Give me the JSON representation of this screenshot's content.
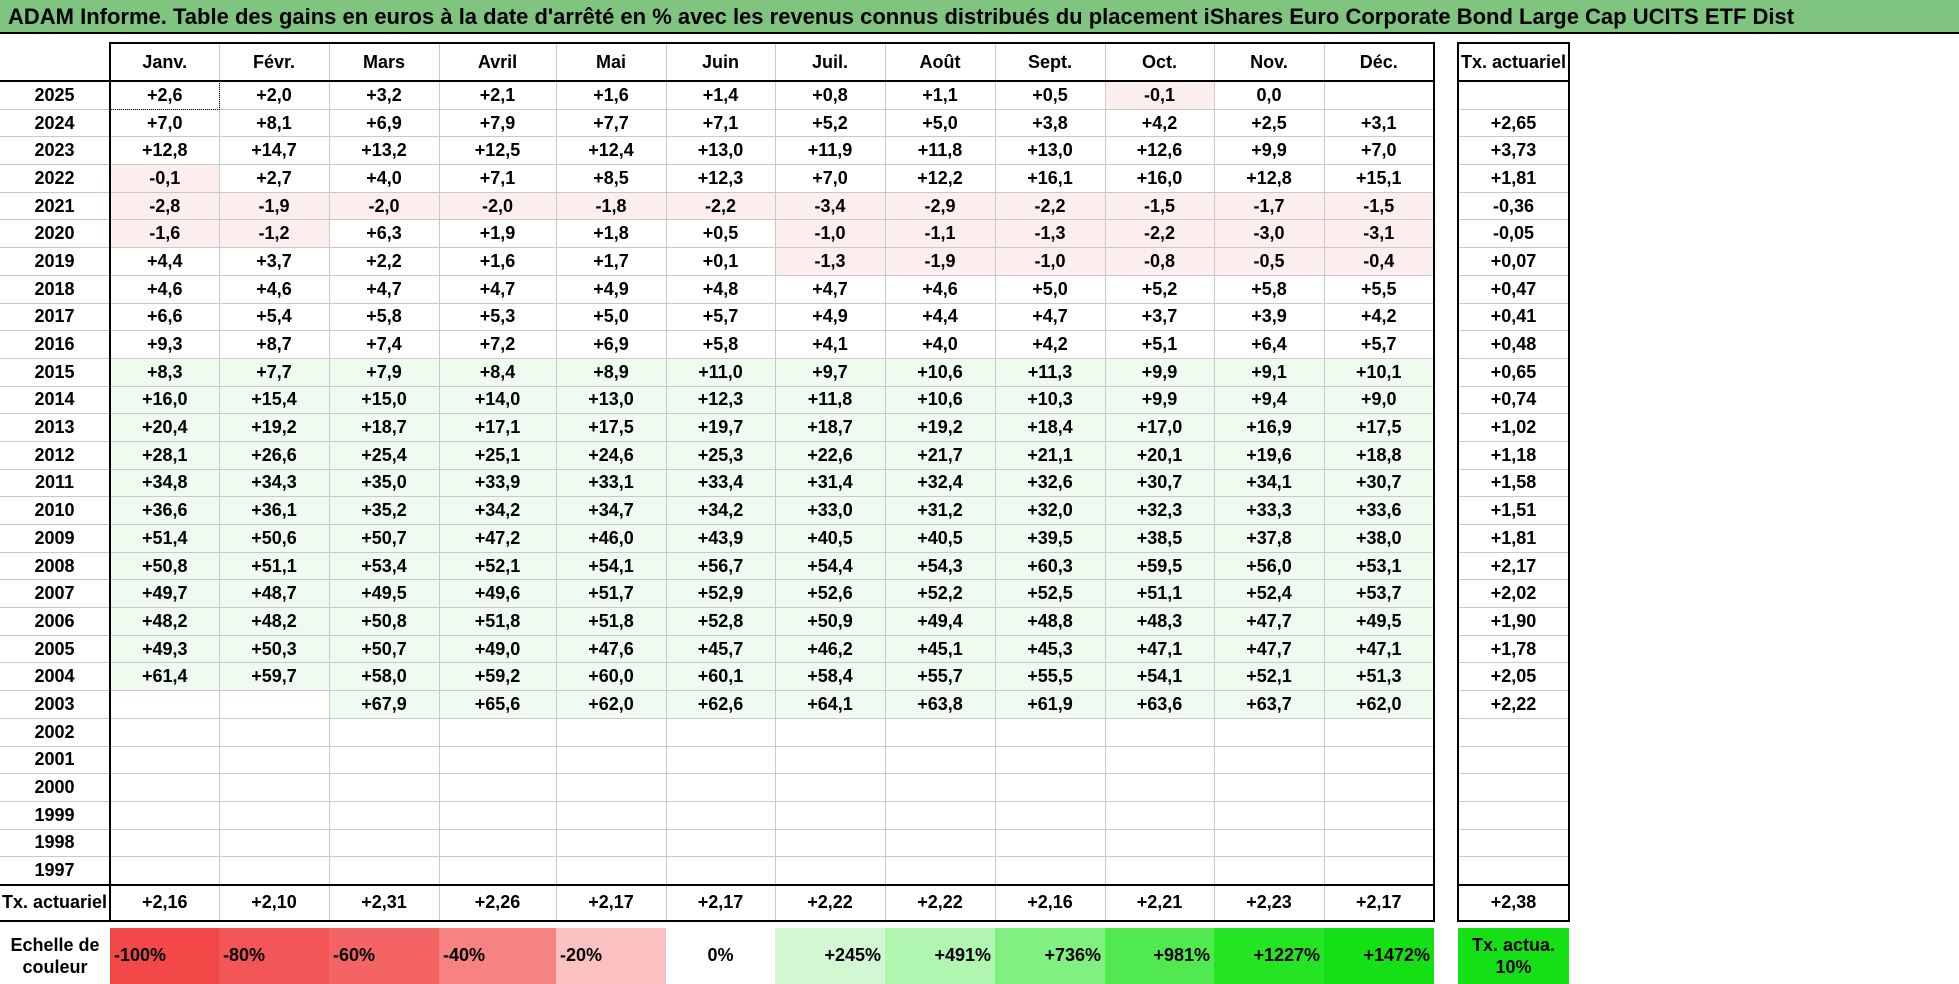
{
  "title": "ADAM Informe. Table des gains en euros à la date d'arrêté en % avec les revenus connus distribués du placement iShares Euro Corporate Bond Large Cap UCITS ETF Dist",
  "months": [
    "Janv.",
    "Févr.",
    "Mars",
    "Avril",
    "Mai",
    "Juin",
    "Juil.",
    "Août",
    "Sept.",
    "Oct.",
    "Nov.",
    "Déc."
  ],
  "tx_header": "Tx. actuariel",
  "rows": [
    {
      "year": "2025",
      "cells": [
        "+2,6",
        "+2,0",
        "+3,2",
        "+2,1",
        "+1,6",
        "+1,4",
        "+0,8",
        "+1,1",
        "+0,5",
        "-0,1",
        "0,0",
        ""
      ],
      "tx": ""
    },
    {
      "year": "2024",
      "cells": [
        "+7,0",
        "+8,1",
        "+6,9",
        "+7,9",
        "+7,7",
        "+7,1",
        "+5,2",
        "+5,0",
        "+3,8",
        "+4,2",
        "+2,5",
        "+3,1"
      ],
      "tx": "+2,65"
    },
    {
      "year": "2023",
      "cells": [
        "+12,8",
        "+14,7",
        "+13,2",
        "+12,5",
        "+12,4",
        "+13,0",
        "+11,9",
        "+11,8",
        "+13,0",
        "+12,6",
        "+9,9",
        "+7,0"
      ],
      "tx": "+3,73"
    },
    {
      "year": "2022",
      "cells": [
        "-0,1",
        "+2,7",
        "+4,0",
        "+7,1",
        "+8,5",
        "+12,3",
        "+7,0",
        "+12,2",
        "+16,1",
        "+16,0",
        "+12,8",
        "+15,1"
      ],
      "tx": "+1,81"
    },
    {
      "year": "2021",
      "cells": [
        "-2,8",
        "-1,9",
        "-2,0",
        "-2,0",
        "-1,8",
        "-2,2",
        "-3,4",
        "-2,9",
        "-2,2",
        "-1,5",
        "-1,7",
        "-1,5"
      ],
      "tx": "-0,36"
    },
    {
      "year": "2020",
      "cells": [
        "-1,6",
        "-1,2",
        "+6,3",
        "+1,9",
        "+1,8",
        "+0,5",
        "-1,0",
        "-1,1",
        "-1,3",
        "-2,2",
        "-3,0",
        "-3,1"
      ],
      "tx": "-0,05"
    },
    {
      "year": "2019",
      "cells": [
        "+4,4",
        "+3,7",
        "+2,2",
        "+1,6",
        "+1,7",
        "+0,1",
        "-1,3",
        "-1,9",
        "-1,0",
        "-0,8",
        "-0,5",
        "-0,4"
      ],
      "tx": "+0,07"
    },
    {
      "year": "2018",
      "cells": [
        "+4,6",
        "+4,6",
        "+4,7",
        "+4,7",
        "+4,9",
        "+4,8",
        "+4,7",
        "+4,6",
        "+5,0",
        "+5,2",
        "+5,8",
        "+5,5"
      ],
      "tx": "+0,47"
    },
    {
      "year": "2017",
      "cells": [
        "+6,6",
        "+5,4",
        "+5,8",
        "+5,3",
        "+5,0",
        "+5,7",
        "+4,9",
        "+4,4",
        "+4,7",
        "+3,7",
        "+3,9",
        "+4,2"
      ],
      "tx": "+0,41"
    },
    {
      "year": "2016",
      "cells": [
        "+9,3",
        "+8,7",
        "+7,4",
        "+7,2",
        "+6,9",
        "+5,8",
        "+4,1",
        "+4,0",
        "+4,2",
        "+5,1",
        "+6,4",
        "+5,7"
      ],
      "tx": "+0,48"
    },
    {
      "year": "2015",
      "cells": [
        "+8,3",
        "+7,7",
        "+7,9",
        "+8,4",
        "+8,9",
        "+11,0",
        "+9,7",
        "+10,6",
        "+11,3",
        "+9,9",
        "+9,1",
        "+10,1"
      ],
      "tx": "+0,65"
    },
    {
      "year": "2014",
      "cells": [
        "+16,0",
        "+15,4",
        "+15,0",
        "+14,0",
        "+13,0",
        "+12,3",
        "+11,8",
        "+10,6",
        "+10,3",
        "+9,9",
        "+9,4",
        "+9,0"
      ],
      "tx": "+0,74"
    },
    {
      "year": "2013",
      "cells": [
        "+20,4",
        "+19,2",
        "+18,7",
        "+17,1",
        "+17,5",
        "+19,7",
        "+18,7",
        "+19,2",
        "+18,4",
        "+17,0",
        "+16,9",
        "+17,5"
      ],
      "tx": "+1,02"
    },
    {
      "year": "2012",
      "cells": [
        "+28,1",
        "+26,6",
        "+25,4",
        "+25,1",
        "+24,6",
        "+25,3",
        "+22,6",
        "+21,7",
        "+21,1",
        "+20,1",
        "+19,6",
        "+18,8"
      ],
      "tx": "+1,18"
    },
    {
      "year": "2011",
      "cells": [
        "+34,8",
        "+34,3",
        "+35,0",
        "+33,9",
        "+33,1",
        "+33,4",
        "+31,4",
        "+32,4",
        "+32,6",
        "+30,7",
        "+34,1",
        "+30,7"
      ],
      "tx": "+1,58"
    },
    {
      "year": "2010",
      "cells": [
        "+36,6",
        "+36,1",
        "+35,2",
        "+34,2",
        "+34,7",
        "+34,2",
        "+33,0",
        "+31,2",
        "+32,0",
        "+32,3",
        "+33,3",
        "+33,6"
      ],
      "tx": "+1,51"
    },
    {
      "year": "2009",
      "cells": [
        "+51,4",
        "+50,6",
        "+50,7",
        "+47,2",
        "+46,0",
        "+43,9",
        "+40,5",
        "+40,5",
        "+39,5",
        "+38,5",
        "+37,8",
        "+38,0"
      ],
      "tx": "+1,81"
    },
    {
      "year": "2008",
      "cells": [
        "+50,8",
        "+51,1",
        "+53,4",
        "+52,1",
        "+54,1",
        "+56,7",
        "+54,4",
        "+54,3",
        "+60,3",
        "+59,5",
        "+56,0",
        "+53,1"
      ],
      "tx": "+2,17"
    },
    {
      "year": "2007",
      "cells": [
        "+49,7",
        "+48,7",
        "+49,5",
        "+49,6",
        "+51,7",
        "+52,9",
        "+52,6",
        "+52,2",
        "+52,5",
        "+51,1",
        "+52,4",
        "+53,7"
      ],
      "tx": "+2,02"
    },
    {
      "year": "2006",
      "cells": [
        "+48,2",
        "+48,2",
        "+50,8",
        "+51,8",
        "+51,8",
        "+52,8",
        "+50,9",
        "+49,4",
        "+48,8",
        "+48,3",
        "+47,7",
        "+49,5"
      ],
      "tx": "+1,90"
    },
    {
      "year": "2005",
      "cells": [
        "+49,3",
        "+50,3",
        "+50,7",
        "+49,0",
        "+47,6",
        "+45,7",
        "+46,2",
        "+45,1",
        "+45,3",
        "+47,1",
        "+47,7",
        "+47,1"
      ],
      "tx": "+1,78"
    },
    {
      "year": "2004",
      "cells": [
        "+61,4",
        "+59,7",
        "+58,0",
        "+59,2",
        "+60,0",
        "+60,1",
        "+58,4",
        "+55,7",
        "+55,5",
        "+54,1",
        "+52,1",
        "+51,3"
      ],
      "tx": "+2,05"
    },
    {
      "year": "2003",
      "cells": [
        "",
        "",
        "+67,9",
        "+65,6",
        "+62,0",
        "+62,6",
        "+64,1",
        "+63,8",
        "+61,9",
        "+63,6",
        "+63,7",
        "+62,0"
      ],
      "tx": "+2,22"
    },
    {
      "year": "2002",
      "cells": [
        "",
        "",
        "",
        "",
        "",
        "",
        "",
        "",
        "",
        "",
        "",
        ""
      ],
      "tx": ""
    },
    {
      "year": "2001",
      "cells": [
        "",
        "",
        "",
        "",
        "",
        "",
        "",
        "",
        "",
        "",
        "",
        ""
      ],
      "tx": ""
    },
    {
      "year": "2000",
      "cells": [
        "",
        "",
        "",
        "",
        "",
        "",
        "",
        "",
        "",
        "",
        "",
        ""
      ],
      "tx": ""
    },
    {
      "year": "1999",
      "cells": [
        "",
        "",
        "",
        "",
        "",
        "",
        "",
        "",
        "",
        "",
        "",
        ""
      ],
      "tx": ""
    },
    {
      "year": "1998",
      "cells": [
        "",
        "",
        "",
        "",
        "",
        "",
        "",
        "",
        "",
        "",
        "",
        ""
      ],
      "tx": ""
    },
    {
      "year": "1997",
      "cells": [
        "",
        "",
        "",
        "",
        "",
        "",
        "",
        "",
        "",
        "",
        "",
        ""
      ],
      "tx": ""
    }
  ],
  "avg_row": {
    "label": "Tx. actuariel",
    "cells": [
      "+2,16",
      "+2,10",
      "+2,31",
      "+2,26",
      "+2,17",
      "+2,17",
      "+2,22",
      "+2,22",
      "+2,16",
      "+2,21",
      "+2,23",
      "+2,17"
    ],
    "tx": "+2,38"
  },
  "scale": {
    "label": "Echelle de couleur",
    "cells": [
      {
        "text": "-100%",
        "bg": "#f24848",
        "align": "left"
      },
      {
        "text": "-80%",
        "bg": "#f35656",
        "align": "left"
      },
      {
        "text": "-60%",
        "bg": "#f46464",
        "align": "left"
      },
      {
        "text": "-40%",
        "bg": "#f68282",
        "align": "left"
      },
      {
        "text": "-20%",
        "bg": "#fbc0c0",
        "align": "left"
      },
      {
        "text": "0%",
        "bg": "#ffffff",
        "align": "center"
      },
      {
        "text": "+245%",
        "bg": "#d3f7d3",
        "align": "right"
      },
      {
        "text": "+491%",
        "bg": "#b0f5b0",
        "align": "right"
      },
      {
        "text": "+736%",
        "bg": "#80f080",
        "align": "right"
      },
      {
        "text": "+981%",
        "bg": "#50ea50",
        "align": "right"
      },
      {
        "text": "+1227%",
        "bg": "#24e424",
        "align": "right"
      },
      {
        "text": "+1472%",
        "bg": "#15e015",
        "align": "right"
      }
    ],
    "tx_label": "Tx. actua. 10%",
    "tx_bg": "#15e015"
  }
}
